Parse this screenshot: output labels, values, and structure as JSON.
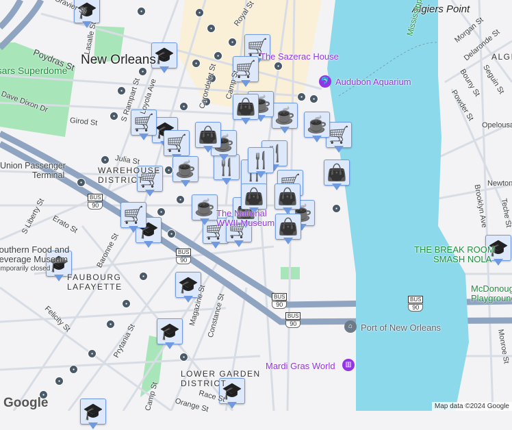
{
  "map": {
    "city_label": "New Orleans",
    "districts": [
      "WAREHOUSE DISTRICT",
      "FAUBOURG LAFAYETTE",
      "LOWER GARDEN DISTRICT",
      "ALGIERS"
    ],
    "neighborhood": "Algiers Point",
    "river_label": "Mississippi River",
    "streets": [
      "Gravier St",
      "Poydras St",
      "Dave Dixon Dr",
      "Girod St",
      "Julia St",
      "S Rampart St",
      "Loyola Ave",
      "Baronne St",
      "Carondelet St",
      "Camp St",
      "Royal St",
      "Erato St",
      "Felicity St",
      "Prytania St",
      "Magazine St",
      "Constance St",
      "Race St",
      "Orange St",
      "S Liberty St",
      "Morgan St",
      "Delaronde St",
      "Bouny St",
      "Seguin St",
      "Powder St",
      "Opelousas Ave",
      "Newton St",
      "Brooklyn Ave",
      "Teche St",
      "Monroe St",
      "Lasalle St"
    ],
    "pois": {
      "superdome": "Caesars Superdome",
      "sazerac": "The Sazerac House",
      "aquarium": "Audubon Aquarium",
      "museum": "The National WWII Museum",
      "food_museum_1": "Southern Food and",
      "food_museum_2": "Beverage Museum",
      "food_museum_3": "Temporarily closed",
      "terminal_1": "Union Passenger",
      "terminal_2": "Terminal",
      "break_room_1": "THE BREAK ROOM",
      "break_room_2": "SMASH NOLA",
      "playground_1": "McDonough",
      "playground_2": "Playground",
      "port": "Port of New Orleans",
      "mardi_gras": "Mardi Gras World"
    },
    "route_shield_top": "BUS",
    "route_shield_num": "90",
    "google_logo": "Google",
    "attribution": "Map data ©2024 Google"
  },
  "markers": [
    {
      "icon": "graduation-cap-icon"
    },
    {
      "icon": "graduation-cap-icon"
    },
    {
      "icon": "graduation-cap-icon"
    },
    {
      "icon": "graduation-cap-icon"
    },
    {
      "icon": "graduation-cap-icon"
    },
    {
      "icon": "graduation-cap-icon"
    },
    {
      "icon": "graduation-cap-icon"
    },
    {
      "icon": "graduation-cap-icon"
    },
    {
      "icon": "graduation-cap-icon"
    },
    {
      "icon": "graduation-cap-icon"
    },
    {
      "icon": "shopping-cart-icon"
    },
    {
      "icon": "shopping-cart-icon"
    },
    {
      "icon": "shopping-cart-icon"
    },
    {
      "icon": "shopping-cart-icon"
    },
    {
      "icon": "shopping-cart-icon"
    },
    {
      "icon": "shopping-cart-icon"
    },
    {
      "icon": "shopping-cart-icon"
    },
    {
      "icon": "shopping-cart-icon"
    },
    {
      "icon": "shopping-cart-icon"
    },
    {
      "icon": "shopping-cart-icon"
    },
    {
      "icon": "fork-knife-icon"
    },
    {
      "icon": "fork-knife-icon"
    },
    {
      "icon": "fork-knife-icon"
    },
    {
      "icon": "fork-knife-icon"
    },
    {
      "icon": "coffee-cup-icon"
    },
    {
      "icon": "coffee-cup-icon"
    },
    {
      "icon": "coffee-cup-icon"
    },
    {
      "icon": "coffee-cup-icon"
    },
    {
      "icon": "coffee-cup-icon"
    },
    {
      "icon": "coffee-cup-icon"
    },
    {
      "icon": "coffee-cup-icon"
    },
    {
      "icon": "shopping-bag-icon"
    },
    {
      "icon": "shopping-bag-icon"
    },
    {
      "icon": "shopping-bag-icon"
    },
    {
      "icon": "shopping-bag-icon"
    },
    {
      "icon": "shopping-bag-icon"
    },
    {
      "icon": "shopping-bag-icon"
    },
    {
      "icon": "shopping-bag-icon"
    }
  ],
  "colors": {
    "water": "#8cd9ec",
    "park": "#a8e6b9",
    "land": "#f3f2f4",
    "quarter": "#faf0d8",
    "highway": "#8ea4c0",
    "marker_bg": "#dde8fb",
    "marker_icon": "#0b4068"
  }
}
